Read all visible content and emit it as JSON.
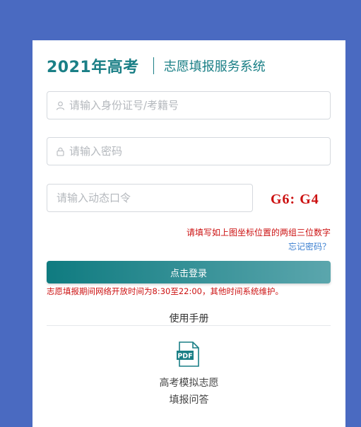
{
  "header": {
    "year_title": "2021年高考",
    "system_title": "志愿填报服务系统"
  },
  "form": {
    "id_placeholder": "请输入身份证号/考籍号",
    "password_placeholder": "请输入密码",
    "dynamic_placeholder": "请输入动态口令",
    "coordinate_challenge": "G6: G4",
    "coordinate_hint": "请填写如上图坐标位置的两组三位数字",
    "forgot_password": "忘记密码？",
    "login_label": "点击登录",
    "notice": "志愿填报期间网络开放时间为8:30至22:00，其他时间系统维护。"
  },
  "manual": {
    "title": "使用手册",
    "pdf_label": "PDF",
    "faq_line1": "高考模拟志愿",
    "faq_line2": "填报问答"
  },
  "colors": {
    "background": "#4a6ac1",
    "brand": "#1a7f86",
    "alert": "#cc1111",
    "link": "#3b7fd0"
  },
  "icons": [
    "user-icon",
    "lock-icon",
    "pdf-icon"
  ]
}
